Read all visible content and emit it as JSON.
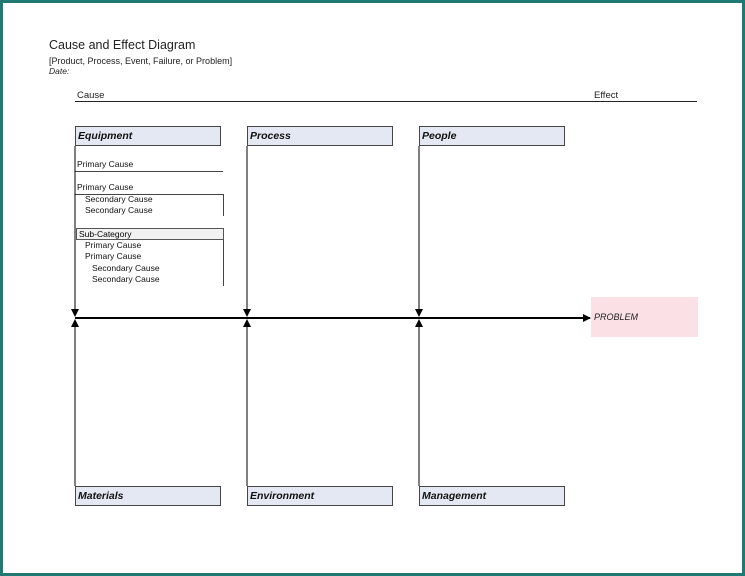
{
  "diagram": {
    "title": "Cause and Effect Diagram",
    "subtitle": "[Product, Process, Event, Failure, or Problem]",
    "date_label": "Date:",
    "cause_label": "Cause",
    "effect_label": "Effect",
    "problem": "PROBLEM",
    "categories_top": [
      "Equipment",
      "Process",
      "People"
    ],
    "categories_bottom": [
      "Materials",
      "Environment",
      "Management"
    ],
    "equipment_causes": {
      "primary_1": "Primary Cause",
      "primary_2": "Primary Cause",
      "secondary_1": "Secondary Cause",
      "secondary_2": "Secondary Cause",
      "subcategory": "Sub-Category",
      "sub_primary_1": "Primary Cause",
      "sub_primary_2": "Primary Cause",
      "sub_secondary_1": "Secondary Cause",
      "sub_secondary_2": "Secondary Cause"
    }
  },
  "colors": {
    "frame": "#1f7a73",
    "category_fill": "#e3e8f2",
    "problem_fill": "#fbe0e6",
    "line": "#000000"
  }
}
